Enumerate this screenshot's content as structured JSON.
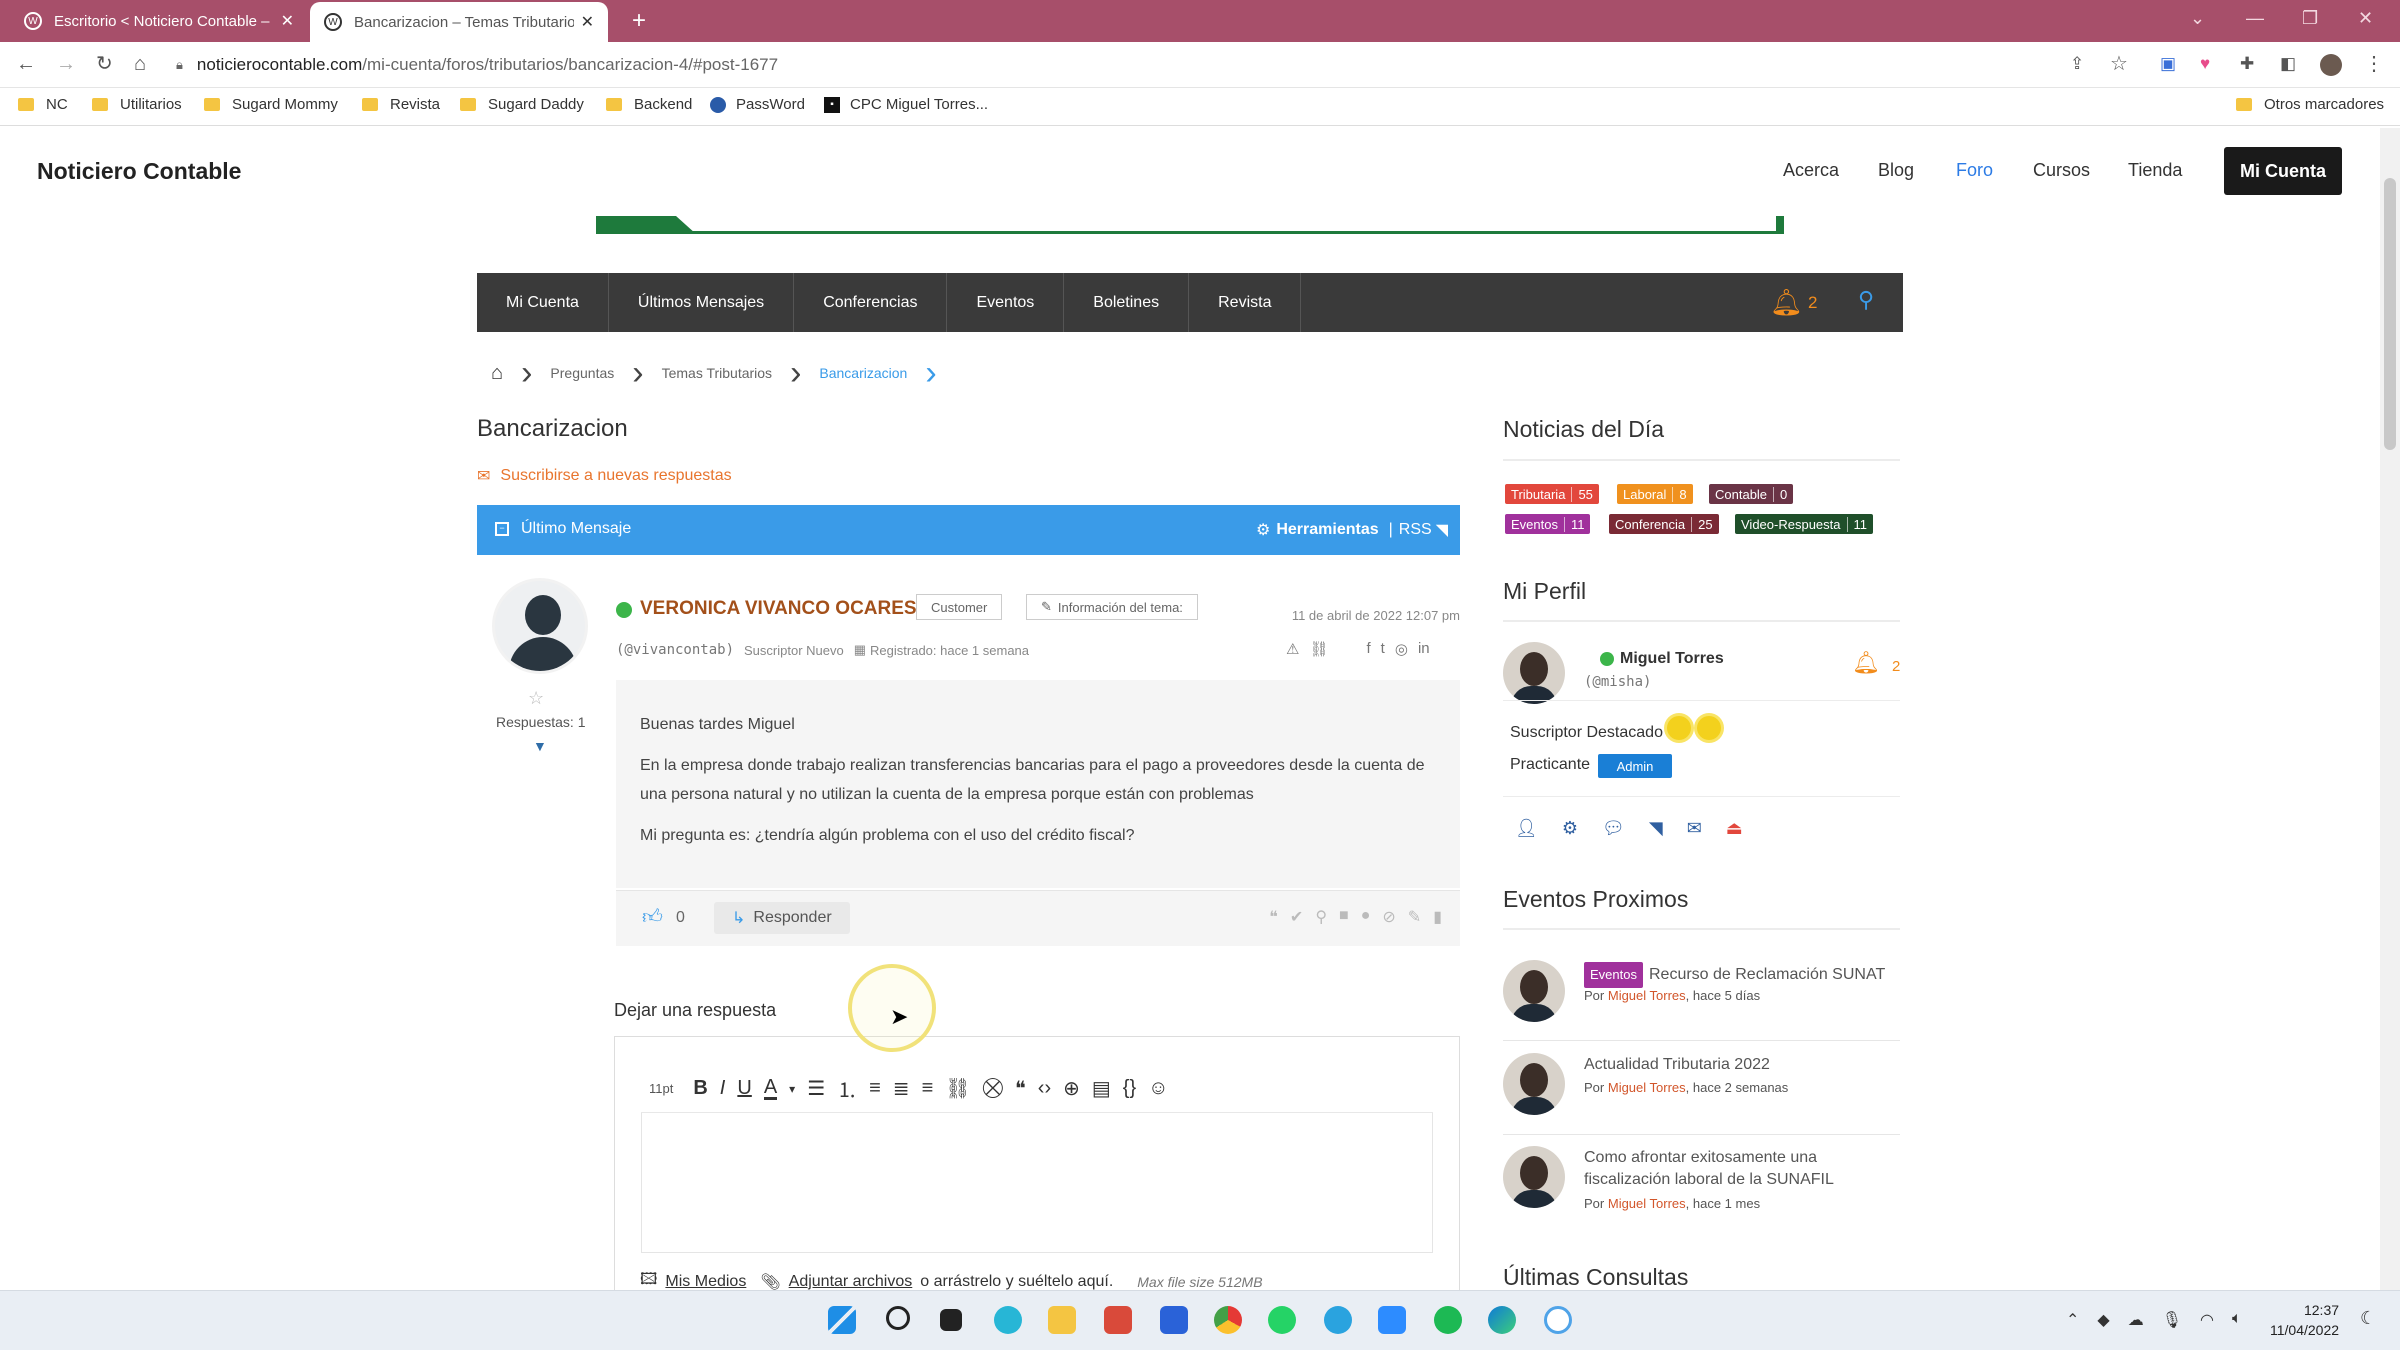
{
  "browser": {
    "tabs": [
      {
        "title": "Escritorio < Noticiero Contable –"
      },
      {
        "title": "Bancarizacion – Temas Tributarios"
      }
    ],
    "url_host": "noticierocontable.com",
    "url_path": "/mi-cuenta/foros/tributarios/bancarizacion-4/#post-1677",
    "bookmarks": [
      "NC",
      "Utilitarios",
      "Sugard Mommy",
      "Revista",
      "Sugard Daddy",
      "Backend",
      "PassWord",
      "CPC Miguel Torres..."
    ],
    "other_bookmarks": "Otros marcadores"
  },
  "site": {
    "logo": "Noticiero Contable",
    "nav": [
      "Acerca",
      "Blog",
      "Foro",
      "Cursos",
      "Tienda"
    ],
    "cta": "Mi Cuenta"
  },
  "forum_menu": {
    "items": [
      "Mi Cuenta",
      "Últimos Mensajes",
      "Conferencias",
      "Eventos",
      "Boletines",
      "Revista"
    ],
    "notif_count": "2"
  },
  "breadcrumb": [
    "Preguntas",
    "Temas Tributarios",
    "Bancarizacion"
  ],
  "topic": {
    "title": "Bancarizacion",
    "subscribe": "Suscribirse a nuevas respuestas",
    "bar_left": "Último Mensaje",
    "bar_tools": "Herramientas",
    "bar_rss": "RSS"
  },
  "post": {
    "author": "VERONICA VIVANCO OCARESCA",
    "role_tag": "Customer",
    "info_tag": "Información del tema:",
    "date": "11 de abril de 2022 12:07 pm",
    "handle": "(@vivancontab)",
    "level": "Suscriptor Nuevo",
    "registered": "Registrado: hace 1 semana",
    "replies": "Respuestas: 1",
    "body": [
      "Buenas tardes Miguel",
      "En la empresa donde trabajo realizan transferencias bancarias para el pago a proveedores desde la cuenta de una persona natural y no utilizan la cuenta de la empresa porque están con problemas",
      "Mi pregunta es: ¿tendría algún problema con el uso del crédito fiscal?"
    ],
    "likes": "0",
    "reply_label": "Responder"
  },
  "reply": {
    "heading": "Dejar una respuesta",
    "font_size": "11pt",
    "media_link": "Mis Medios",
    "attach_link": "Adjuntar archivos",
    "attach_text": "o arrástrelo y suéltelo aquí.",
    "max_size": "Max file size 512MB"
  },
  "sidebar": {
    "news_heading": "Noticias del Día",
    "news_badges": [
      {
        "label": "Tributaria",
        "count": "55",
        "color": "#e2473c"
      },
      {
        "label": "Laboral",
        "count": "8",
        "color": "#f0911e"
      },
      {
        "label": "Contable",
        "count": "0",
        "color": "#6a3446"
      },
      {
        "label": "Eventos",
        "count": "11",
        "color": "#a0319c"
      },
      {
        "label": "Conferencia",
        "count": "25",
        "color": "#7a2a35"
      },
      {
        "label": "Video-Respuesta",
        "count": "11",
        "color": "#1f4f2a"
      }
    ],
    "profile_heading": "Mi Perfil",
    "profile_name": "Miguel Torres",
    "profile_handle": "(@misha)",
    "profile_notif": "2",
    "suscriptor": "Suscriptor Destacado",
    "practicante": "Practicante",
    "admin": "Admin",
    "events_heading": "Eventos Proximos",
    "events": [
      {
        "tag": "Eventos",
        "title": "Recurso de Reclamación SUNAT",
        "by": "Por",
        "author": "Miguel Torres",
        "when": ", hace 5 días"
      },
      {
        "tag": "",
        "title": "Actualidad Tributaria 2022",
        "by": "Por",
        "author": "Miguel Torres",
        "when": ", hace 2 semanas"
      },
      {
        "tag": "",
        "title": "Como afrontar exitosamente una fiscalización laboral de la SUNAFIL",
        "by": "Por",
        "author": "Miguel Torres",
        "when": ", hace 1 mes"
      }
    ],
    "last_heading": "Últimas Consultas"
  },
  "taskbar": {
    "time": "12:37",
    "date": "11/04/2022"
  }
}
